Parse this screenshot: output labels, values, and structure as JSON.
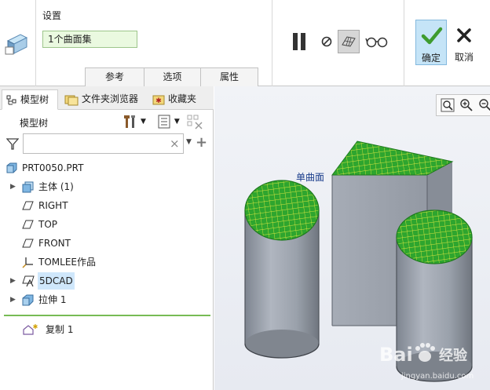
{
  "ribbon": {
    "settings_title": "设置",
    "surface_set_value": "1个曲面集",
    "tabs": [
      {
        "label": "参考"
      },
      {
        "label": "选项"
      },
      {
        "label": "属性"
      }
    ],
    "ok_label": "确定",
    "cancel_label": "取消"
  },
  "panel_tabs": {
    "model_tree": "模型树",
    "folder_browser": "文件夹浏览器",
    "favorites": "收藏夹"
  },
  "tree": {
    "header": "模型树",
    "filter_placeholder": "",
    "items": [
      {
        "label": "PRT0050.PRT",
        "icon": "part-icon"
      },
      {
        "label": "主体 (1)",
        "icon": "body-icon"
      },
      {
        "label": "RIGHT",
        "icon": "datum-plane-icon"
      },
      {
        "label": "TOP",
        "icon": "datum-plane-icon"
      },
      {
        "label": "FRONT",
        "icon": "datum-plane-icon"
      },
      {
        "label": "TOMLEE作品",
        "icon": "csys-icon"
      },
      {
        "label": "5DCAD",
        "icon": "sketch-icon"
      },
      {
        "label": "拉伸 1",
        "icon": "extrude-icon"
      },
      {
        "label": "复制 1",
        "icon": "copy-feature-icon"
      }
    ]
  },
  "graphics": {
    "annotation": "单曲面",
    "watermark_brand": "Bai",
    "watermark_cn": "经验",
    "watermark_url": "jingyan.baidu.com"
  },
  "colors": {
    "accent_selected": "#c5e4f7",
    "surface_green": "#2ea52e",
    "mesh_yellow": "#d8e640",
    "solid_gray": "#9ba2ad"
  }
}
